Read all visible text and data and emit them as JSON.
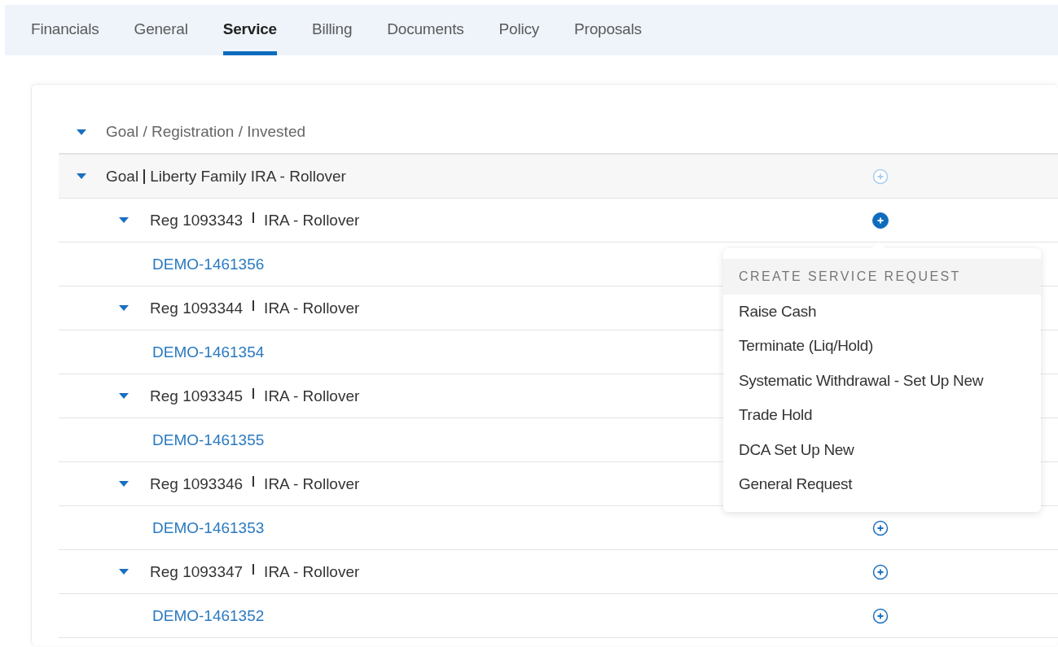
{
  "tabs": [
    {
      "label": "Financials",
      "selected": false
    },
    {
      "label": "General",
      "selected": false
    },
    {
      "label": "Service",
      "selected": true
    },
    {
      "label": "Billing",
      "selected": false
    },
    {
      "label": "Documents",
      "selected": false
    },
    {
      "label": "Policy",
      "selected": false
    },
    {
      "label": "Proposals",
      "selected": false
    }
  ],
  "tree": {
    "header": {
      "label": "Goal / Registration / Invested",
      "expanded": true
    },
    "goal": {
      "prefix": "Goal",
      "name": "Liberty Family IRA - Rollover",
      "expanded": true,
      "add_button": {
        "disabled": true,
        "open": false
      }
    },
    "registrations": [
      {
        "reg": "Reg 1093343",
        "type": "IRA - Rollover",
        "expanded": true,
        "add_button": {
          "disabled": false,
          "open": true
        },
        "accounts": [
          {
            "label": "DEMO-1461356"
          }
        ]
      },
      {
        "reg": "Reg 1093344",
        "type": "IRA - Rollover",
        "expanded": true,
        "accounts": [
          {
            "label": "DEMO-1461354"
          }
        ]
      },
      {
        "reg": "Reg 1093345",
        "type": "IRA - Rollover",
        "expanded": true,
        "accounts": [
          {
            "label": "DEMO-1461355"
          }
        ]
      },
      {
        "reg": "Reg 1093346",
        "type": "IRA - Rollover",
        "expanded": true,
        "accounts": [
          {
            "label": "DEMO-1461353",
            "add_button": {
              "disabled": false,
              "open": false
            }
          }
        ]
      },
      {
        "reg": "Reg 1093347",
        "type": "IRA - Rollover",
        "expanded": true,
        "add_button": {
          "disabled": false,
          "open": false
        },
        "accounts": [
          {
            "label": "DEMO-1461352",
            "add_button": {
              "disabled": false,
              "open": false
            }
          }
        ]
      }
    ]
  },
  "menu": {
    "title": "CREATE SERVICE REQUEST",
    "items": [
      "Raise Cash",
      "Terminate (Liq/Hold)",
      "Systematic Withdrawal - Set Up New",
      "Trade Hold",
      "DCA Set Up New",
      "General Request"
    ]
  }
}
